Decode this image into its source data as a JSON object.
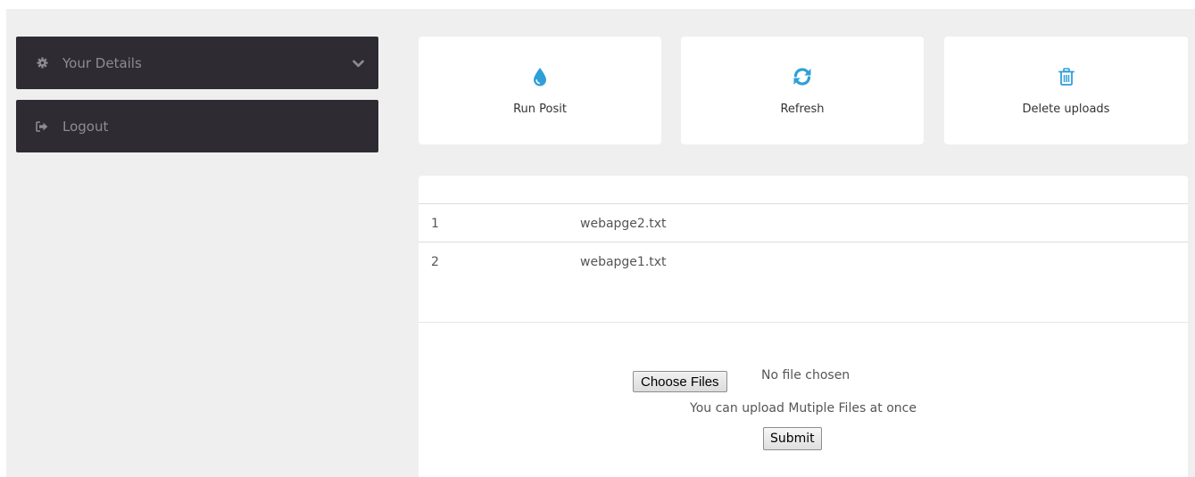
{
  "sidebar": {
    "items": [
      {
        "label": "Your Details",
        "icon": "gear-icon",
        "trailing_icon": "chevron-down-icon"
      },
      {
        "label": "Logout",
        "icon": "sign-out-icon"
      }
    ]
  },
  "actions": [
    {
      "label": "Run Posit",
      "icon": "droplet-icon"
    },
    {
      "label": "Refresh",
      "icon": "refresh-icon"
    },
    {
      "label": "Delete uploads",
      "icon": "trash-icon"
    }
  ],
  "files": {
    "rows": [
      {
        "num": "1",
        "name": "webapge2.txt"
      },
      {
        "num": "2",
        "name": "webapge1.txt"
      }
    ]
  },
  "upload": {
    "choose_label": "Choose Files",
    "status": "No file chosen",
    "hint": "You can upload Mutiple Files at once",
    "submit_label": "Submit"
  },
  "colors": {
    "accent": "#2f9fd8",
    "sidebar_bg": "#2e2c32",
    "page_bg": "#efefef"
  }
}
